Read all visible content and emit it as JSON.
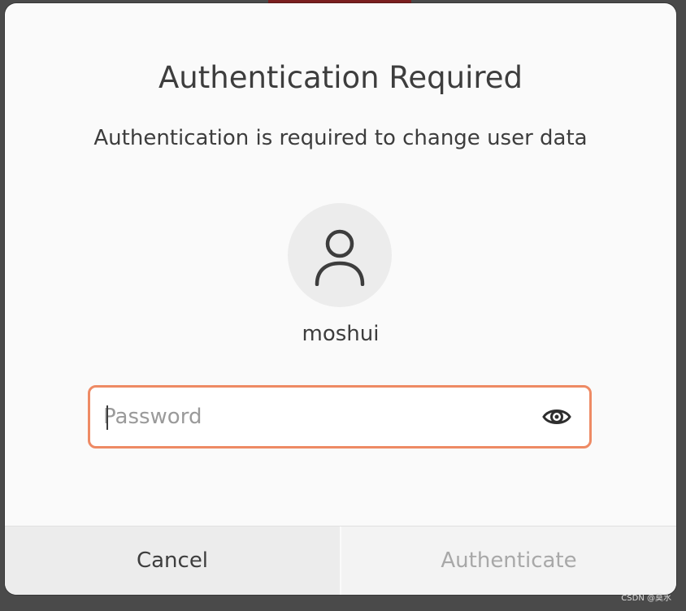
{
  "dialog": {
    "title": "Authentication Required",
    "message": "Authentication is required to change user data",
    "username": "moshui",
    "avatar_icon": "user-icon",
    "password": {
      "placeholder": "Password",
      "value": "",
      "reveal_icon": "eye-icon"
    },
    "buttons": {
      "cancel": "Cancel",
      "authenticate": "Authenticate"
    }
  },
  "watermark": "CSDN @莫水",
  "colors": {
    "focus_border": "#ee8a64",
    "text": "#3d3d3d",
    "disabled_text": "#a8a8a8"
  }
}
